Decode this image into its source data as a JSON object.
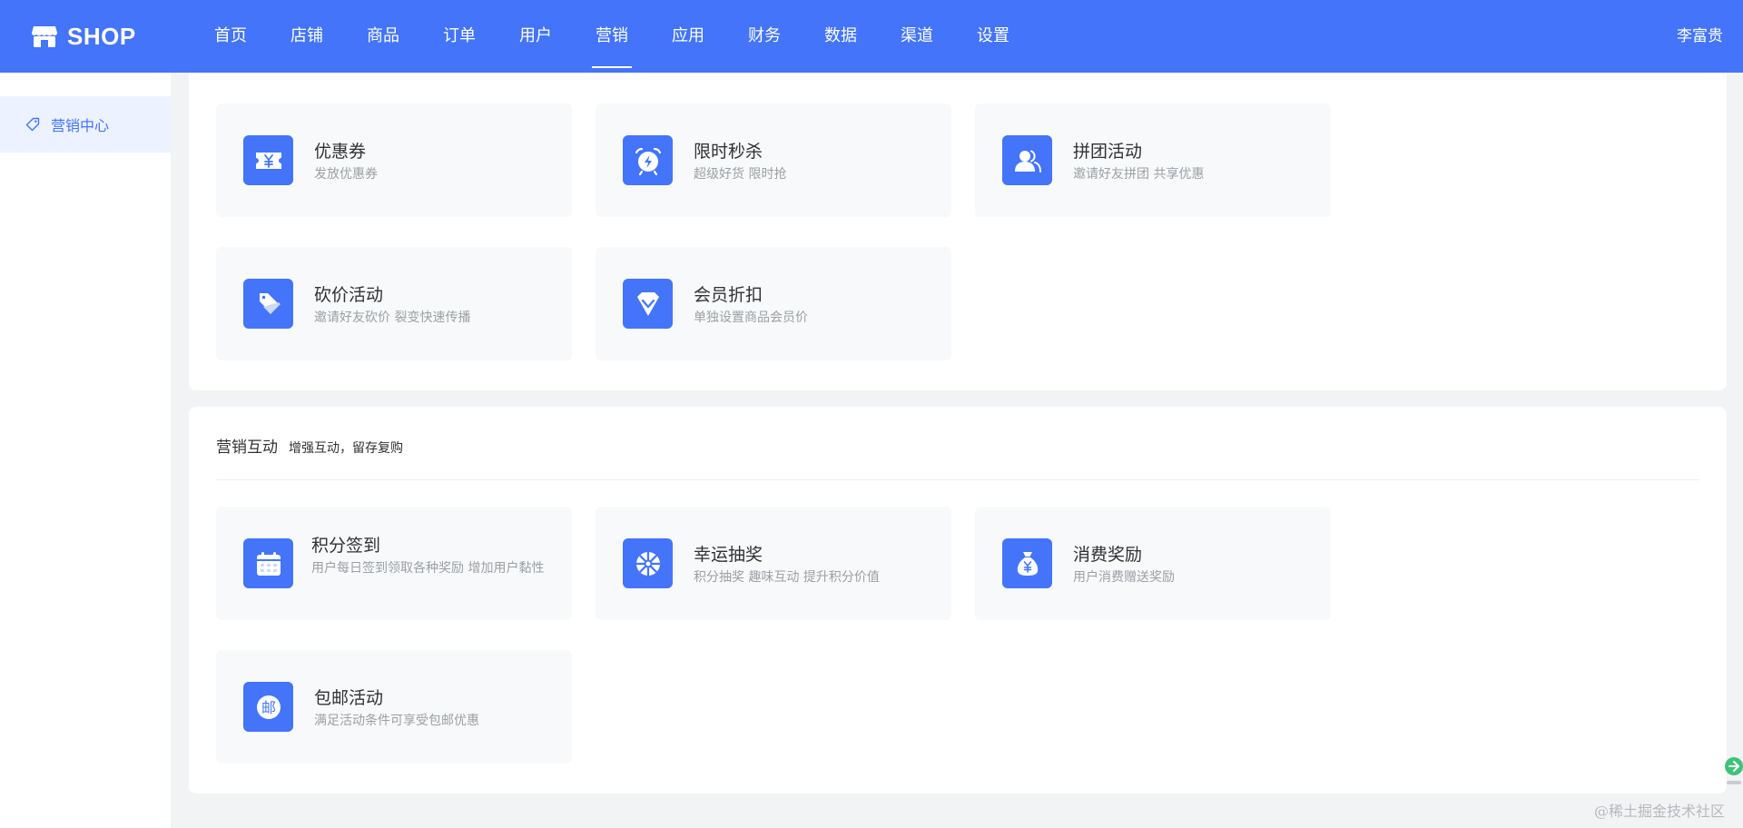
{
  "header": {
    "logo_text": "SHOP",
    "nav": [
      {
        "label": "首页"
      },
      {
        "label": "店铺"
      },
      {
        "label": "商品"
      },
      {
        "label": "订单"
      },
      {
        "label": "用户"
      },
      {
        "label": "营销",
        "active": true
      },
      {
        "label": "应用"
      },
      {
        "label": "财务"
      },
      {
        "label": "数据"
      },
      {
        "label": "渠道"
      },
      {
        "label": "设置"
      }
    ],
    "user_name": "李富贵"
  },
  "sidebar": {
    "items": [
      {
        "label": "营销中心",
        "icon": "tag-icon",
        "active": true
      }
    ]
  },
  "panels": [
    {
      "cards": [
        {
          "title": "优惠券",
          "desc": "发放优惠券",
          "icon": "coupon-icon"
        },
        {
          "title": "限时秒杀",
          "desc": "超级好货 限时抢",
          "icon": "alarm-clock-icon"
        },
        {
          "title": "拼团活动",
          "desc": "邀请好友拼团 共享优惠",
          "icon": "group-users-icon"
        },
        {
          "title": "砍价活动",
          "desc": "邀请好友砍价 裂变快速传播",
          "icon": "price-tag-icon"
        },
        {
          "title": "会员折扣",
          "desc": "单独设置商品会员价",
          "icon": "diamond-icon"
        }
      ]
    },
    {
      "title": "营销互动",
      "subtitle": "增强互动，留存复购",
      "cards": [
        {
          "title": "积分签到",
          "desc": "用户每日签到领取各种奖励 增加用户黏性",
          "icon": "calendar-icon"
        },
        {
          "title": "幸运抽奖",
          "desc": "积分抽奖 趣味互动 提升积分价值",
          "icon": "lucky-wheel-icon"
        },
        {
          "title": "消费奖励",
          "desc": "用户消费赠送奖励",
          "icon": "money-bag-icon"
        },
        {
          "title": "包邮活动",
          "desc": "满足活动条件可享受包邮优惠",
          "icon": "mail-stamp-icon",
          "glyph": "邮"
        }
      ]
    }
  ],
  "watermark": "@稀土掘金技术社区",
  "colors": {
    "primary": "#4374fa",
    "sidebar_active_bg": "#ecf2ff",
    "card_bg": "#f8f9fa",
    "page_bg": "#f2f3f5"
  }
}
